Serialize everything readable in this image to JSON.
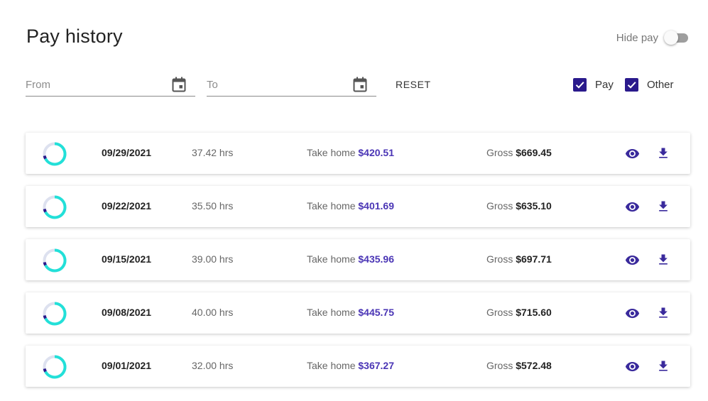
{
  "header": {
    "title": "Pay history",
    "hide_pay_label": "Hide pay",
    "hide_pay_on": false
  },
  "filters": {
    "from_placeholder": "From",
    "to_placeholder": "To",
    "reset_label": "RESET",
    "pay_label": "Pay",
    "pay_checked": true,
    "other_label": "Other",
    "other_checked": true
  },
  "labels": {
    "take_home": "Take home",
    "gross": "Gross"
  },
  "colors": {
    "accent": "#2a1a8c",
    "link": "#4a35b5",
    "ring": "#22e0d8",
    "ring_segment": "#2a1a8c",
    "ring_track": "#dde1ef"
  },
  "icons": {
    "calendar": "calendar-icon",
    "view": "eye-icon",
    "download": "download-icon",
    "check": "check-icon"
  },
  "pay_rows": [
    {
      "date": "09/29/2021",
      "hours": "37.42 hrs",
      "take_home": "$420.51",
      "gross": "$669.45"
    },
    {
      "date": "09/22/2021",
      "hours": "35.50 hrs",
      "take_home": "$401.69",
      "gross": "$635.10"
    },
    {
      "date": "09/15/2021",
      "hours": "39.00 hrs",
      "take_home": "$435.96",
      "gross": "$697.71"
    },
    {
      "date": "09/08/2021",
      "hours": "40.00 hrs",
      "take_home": "$445.75",
      "gross": "$715.60"
    },
    {
      "date": "09/01/2021",
      "hours": "32.00 hrs",
      "take_home": "$367.27",
      "gross": "$572.48"
    }
  ]
}
